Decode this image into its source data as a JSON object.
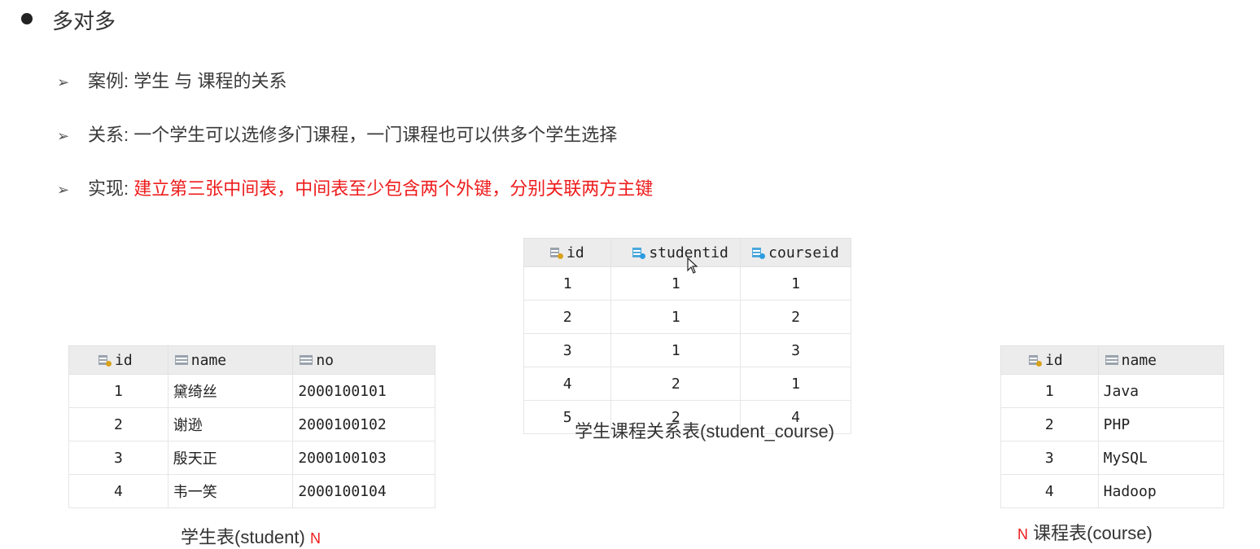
{
  "heading": "多对多",
  "bullets": [
    {
      "label": "案例: ",
      "text": "学生 与 课程的关系"
    },
    {
      "label": "关系: ",
      "text": "一个学生可以选修多门课程，一门课程也可以供多个学生选择"
    },
    {
      "label": "实现: ",
      "text": "建立第三张中间表，中间表至少包含两个外键，分别关联两方主键"
    }
  ],
  "student_table": {
    "columns": [
      "id",
      "name",
      "no"
    ],
    "rows": [
      [
        "1",
        "黛绮丝",
        "2000100101"
      ],
      [
        "2",
        "谢逊",
        "2000100102"
      ],
      [
        "3",
        "殷天正",
        "2000100103"
      ],
      [
        "4",
        "韦一笑",
        "2000100104"
      ]
    ],
    "caption": "学生表(student)",
    "marker": "N"
  },
  "relation_table": {
    "columns": [
      "id",
      "studentid",
      "courseid"
    ],
    "rows": [
      [
        "1",
        "1",
        "1"
      ],
      [
        "2",
        "1",
        "2"
      ],
      [
        "3",
        "1",
        "3"
      ],
      [
        "4",
        "2",
        "1"
      ],
      [
        "5",
        "2",
        "4"
      ]
    ],
    "caption": "学生课程关系表(student_course)"
  },
  "course_table": {
    "columns": [
      "id",
      "name"
    ],
    "rows": [
      [
        "1",
        "Java"
      ],
      [
        "2",
        "PHP"
      ],
      [
        "3",
        "MySQL"
      ],
      [
        "4",
        "Hadoop"
      ]
    ],
    "caption": "课程表(course)",
    "marker": "N"
  },
  "colors": {
    "highlight": "#ee1c1c"
  }
}
